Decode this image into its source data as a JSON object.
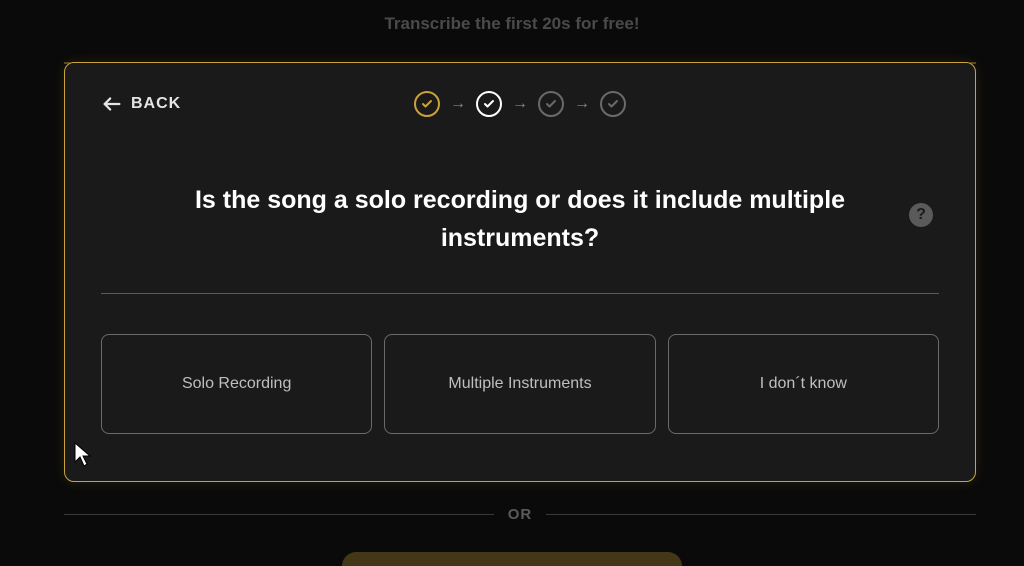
{
  "banner": "Transcribe the first 20s for free!",
  "modal": {
    "back_label": "BACK",
    "question": "Is the song a solo recording or does it include multiple instruments?",
    "options": [
      "Solo Recording",
      "Multiple Instruments",
      "I don´t know"
    ],
    "help_icon": "?"
  },
  "stepper": {
    "steps": [
      {
        "state": "done"
      },
      {
        "state": "active"
      },
      {
        "state": "pending"
      },
      {
        "state": "pending"
      }
    ]
  },
  "or_label": "OR"
}
